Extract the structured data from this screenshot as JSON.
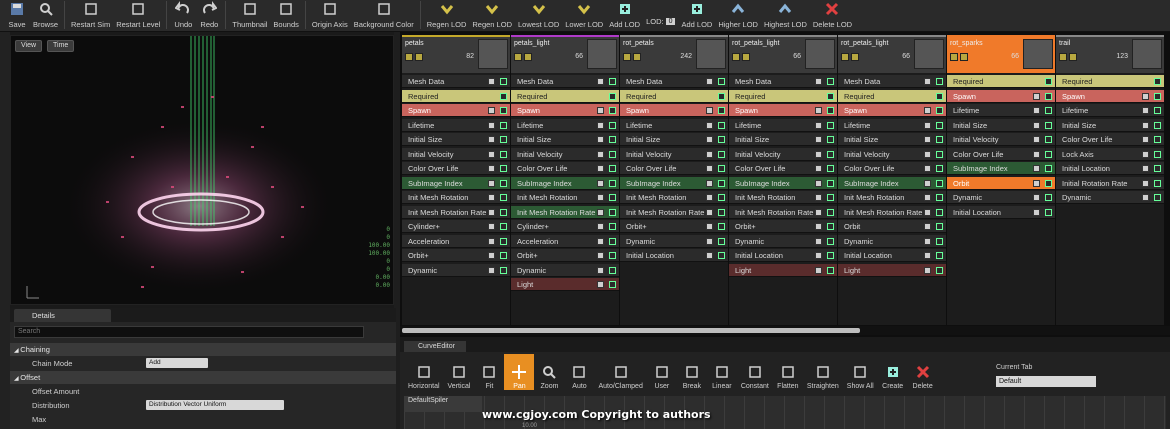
{
  "toolbar": {
    "buttons": [
      {
        "label": "Save",
        "icon": "save-icon"
      },
      {
        "label": "Browse",
        "icon": "browse-icon"
      },
      {
        "label": "Restart Sim",
        "icon": "restart-sim-icon"
      },
      {
        "label": "Restart Level",
        "icon": "restart-level-icon"
      },
      {
        "label": "Undo",
        "icon": "undo-icon"
      },
      {
        "label": "Redo",
        "icon": "redo-icon"
      },
      {
        "label": "Thumbnail",
        "icon": "thumbnail-icon"
      },
      {
        "label": "Bounds",
        "icon": "bounds-icon"
      },
      {
        "label": "Origin Axis",
        "icon": "origin-axis-icon"
      },
      {
        "label": "Background Color",
        "icon": "background-color-icon"
      },
      {
        "label": "Regen LOD",
        "icon": "regen-lod-icon"
      },
      {
        "label": "Regen LOD",
        "icon": "regen-lod-icon"
      },
      {
        "label": "Lowest LOD",
        "icon": "lowest-lod-icon"
      },
      {
        "label": "Lower LOD",
        "icon": "lower-lod-icon"
      },
      {
        "label": "Add LOD",
        "icon": "add-lod-icon"
      }
    ],
    "lod_label": "LOD:",
    "lod_value": "0",
    "buttons_right": [
      {
        "label": "Add LOD",
        "icon": "add-lod-icon"
      },
      {
        "label": "Higher LOD",
        "icon": "higher-lod-icon"
      },
      {
        "label": "Highest LOD",
        "icon": "highest-lod-icon"
      },
      {
        "label": "Delete LOD",
        "icon": "delete-lod-icon"
      }
    ]
  },
  "viewport": {
    "view_button": "View",
    "time_button": "Time",
    "stats": [
      "0",
      "0",
      "100.00",
      "100.00",
      "0",
      "0",
      "0.00",
      "0.00"
    ]
  },
  "details": {
    "tab_label": "Details",
    "search_placeholder": "Search",
    "rows": [
      {
        "type": "category",
        "label": "Chaining"
      },
      {
        "type": "prop",
        "label": "Chain Mode",
        "value": "Add"
      },
      {
        "type": "category",
        "label": "Offset"
      },
      {
        "type": "prop",
        "label": "Offset Amount",
        "value": ""
      },
      {
        "type": "prop",
        "label": "Distribution",
        "value": "Distribution Vector Uniform"
      },
      {
        "type": "prop",
        "label": "Max",
        "value": ""
      }
    ]
  },
  "emitters": [
    {
      "name": "petals",
      "count": "82",
      "color": "#c4a92a",
      "modules": [
        {
          "label": "Mesh Data",
          "style": "default"
        },
        {
          "label": "Required",
          "style": "required"
        },
        {
          "label": "Spawn",
          "style": "spawn"
        },
        {
          "label": "Lifetime",
          "style": "default"
        },
        {
          "label": "Initial Size",
          "style": "default"
        },
        {
          "label": "Initial Velocity",
          "style": "default"
        },
        {
          "label": "Color Over Life",
          "style": "default"
        },
        {
          "label": "SubImage Index",
          "style": "green"
        },
        {
          "label": "Init Mesh Rotation",
          "style": "default"
        },
        {
          "label": "Init Mesh Rotation Rate",
          "style": "default"
        },
        {
          "label": "Cylinder+",
          "style": "default"
        },
        {
          "label": "Acceleration",
          "style": "default"
        },
        {
          "label": "Orbit+",
          "style": "default"
        },
        {
          "label": "Dynamic",
          "style": "default"
        }
      ]
    },
    {
      "name": "petals_light",
      "count": "66",
      "color": "#b03ac9",
      "modules": [
        {
          "label": "Mesh Data",
          "style": "default"
        },
        {
          "label": "Required",
          "style": "required"
        },
        {
          "label": "Spawn",
          "style": "spawn"
        },
        {
          "label": "Lifetime",
          "style": "default"
        },
        {
          "label": "Initial Size",
          "style": "default"
        },
        {
          "label": "Initial Velocity",
          "style": "default"
        },
        {
          "label": "Color Over Life",
          "style": "default"
        },
        {
          "label": "SubImage Index",
          "style": "green"
        },
        {
          "label": "Init Mesh Rotation",
          "style": "default"
        },
        {
          "label": "Init Mesh Rotation Rate",
          "style": "green"
        },
        {
          "label": "Cylinder+",
          "style": "default"
        },
        {
          "label": "Acceleration",
          "style": "default"
        },
        {
          "label": "Orbit+",
          "style": "default"
        },
        {
          "label": "Dynamic",
          "style": "default"
        },
        {
          "label": "Light",
          "style": "light"
        }
      ]
    },
    {
      "name": "rot_petals",
      "count": "242",
      "color": "#888888",
      "modules": [
        {
          "label": "Mesh Data",
          "style": "default"
        },
        {
          "label": "Required",
          "style": "required"
        },
        {
          "label": "Spawn",
          "style": "spawn"
        },
        {
          "label": "Lifetime",
          "style": "default"
        },
        {
          "label": "Initial Size",
          "style": "default"
        },
        {
          "label": "Initial Velocity",
          "style": "default"
        },
        {
          "label": "Color Over Life",
          "style": "default"
        },
        {
          "label": "SubImage Index",
          "style": "green"
        },
        {
          "label": "Init Mesh Rotation",
          "style": "default"
        },
        {
          "label": "Init Mesh Rotation Rate",
          "style": "default"
        },
        {
          "label": "Orbit+",
          "style": "default"
        },
        {
          "label": "Dynamic",
          "style": "default"
        },
        {
          "label": "Initial Location",
          "style": "default"
        }
      ]
    },
    {
      "name": "rot_petals_light",
      "count": "66",
      "color": "#888888",
      "modules": [
        {
          "label": "Mesh Data",
          "style": "default"
        },
        {
          "label": "Required",
          "style": "required"
        },
        {
          "label": "Spawn",
          "style": "spawn"
        },
        {
          "label": "Lifetime",
          "style": "default"
        },
        {
          "label": "Initial Size",
          "style": "default"
        },
        {
          "label": "Initial Velocity",
          "style": "default"
        },
        {
          "label": "Color Over Life",
          "style": "default"
        },
        {
          "label": "SubImage Index",
          "style": "green"
        },
        {
          "label": "Init Mesh Rotation",
          "style": "default"
        },
        {
          "label": "Init Mesh Rotation Rate",
          "style": "default"
        },
        {
          "label": "Orbit+",
          "style": "default"
        },
        {
          "label": "Dynamic",
          "style": "default"
        },
        {
          "label": "Initial Location",
          "style": "default"
        },
        {
          "label": "Light",
          "style": "light"
        }
      ]
    },
    {
      "name": "rot_petals_light",
      "count": "66",
      "color": "#888888",
      "modules": [
        {
          "label": "Mesh Data",
          "style": "default"
        },
        {
          "label": "Required",
          "style": "required"
        },
        {
          "label": "Spawn",
          "style": "spawn"
        },
        {
          "label": "Lifetime",
          "style": "default"
        },
        {
          "label": "Initial Size",
          "style": "default"
        },
        {
          "label": "Initial Velocity",
          "style": "default"
        },
        {
          "label": "Color Over Life",
          "style": "default"
        },
        {
          "label": "SubImage Index",
          "style": "green"
        },
        {
          "label": "Init Mesh Rotation",
          "style": "default"
        },
        {
          "label": "Init Mesh Rotation Rate",
          "style": "default"
        },
        {
          "label": "Orbit",
          "style": "default"
        },
        {
          "label": "Dynamic",
          "style": "default"
        },
        {
          "label": "Initial Location",
          "style": "default"
        },
        {
          "label": "Light",
          "style": "light"
        }
      ]
    },
    {
      "name": "rot_sparks",
      "count": "66",
      "color": "#f07a2a",
      "selected": true,
      "modules": [
        {
          "label": "Required",
          "style": "required"
        },
        {
          "label": "Spawn",
          "style": "spawn"
        },
        {
          "label": "Lifetime",
          "style": "default"
        },
        {
          "label": "Initial Size",
          "style": "default"
        },
        {
          "label": "Initial Velocity",
          "style": "default"
        },
        {
          "label": "Color Over Life",
          "style": "default"
        },
        {
          "label": "SubImage Index",
          "style": "green"
        },
        {
          "label": "Orbit",
          "style": "orange"
        },
        {
          "label": "Dynamic",
          "style": "default"
        },
        {
          "label": "Initial Location",
          "style": "default"
        }
      ]
    },
    {
      "name": "trail",
      "count": "123",
      "color": "#888888",
      "modules": [
        {
          "label": "Required",
          "style": "required"
        },
        {
          "label": "Spawn",
          "style": "spawn"
        },
        {
          "label": "Lifetime",
          "style": "default"
        },
        {
          "label": "Initial Size",
          "style": "default"
        },
        {
          "label": "Color Over Life",
          "style": "default"
        },
        {
          "label": "Lock Axis",
          "style": "default"
        },
        {
          "label": "Initial Location",
          "style": "default"
        },
        {
          "label": "Initial Rotation Rate",
          "style": "default"
        },
        {
          "label": "Dynamic",
          "style": "default"
        }
      ]
    }
  ],
  "curve_editor": {
    "tab_label": "CurveEditor",
    "tools": [
      {
        "label": "Horizontal",
        "icon": "horizontal-fit-icon"
      },
      {
        "label": "Vertical",
        "icon": "vertical-fit-icon"
      },
      {
        "label": "Fit",
        "icon": "fit-icon"
      },
      {
        "label": "Pan",
        "icon": "pan-icon",
        "active": true
      },
      {
        "label": "Zoom",
        "icon": "zoom-icon"
      },
      {
        "label": "Auto",
        "icon": "auto-tangent-icon"
      },
      {
        "label": "Auto/Clamped",
        "icon": "auto-clamped-icon"
      },
      {
        "label": "User",
        "icon": "user-tangent-icon"
      },
      {
        "label": "Break",
        "icon": "break-tangent-icon"
      },
      {
        "label": "Linear",
        "icon": "linear-icon"
      },
      {
        "label": "Constant",
        "icon": "constant-icon"
      },
      {
        "label": "Flatten",
        "icon": "flatten-icon"
      },
      {
        "label": "Straighten",
        "icon": "straighten-icon"
      },
      {
        "label": "Show All",
        "icon": "show-all-icon"
      },
      {
        "label": "Create",
        "icon": "create-icon"
      },
      {
        "label": "Delete",
        "icon": "delete-icon"
      }
    ],
    "current_tab_label": "Current Tab",
    "current_tab_value": "Default",
    "track_label": "DefaultSpiler",
    "tick_label": "10.00"
  },
  "watermark": "www.cgjoy.com Copyright to authors"
}
